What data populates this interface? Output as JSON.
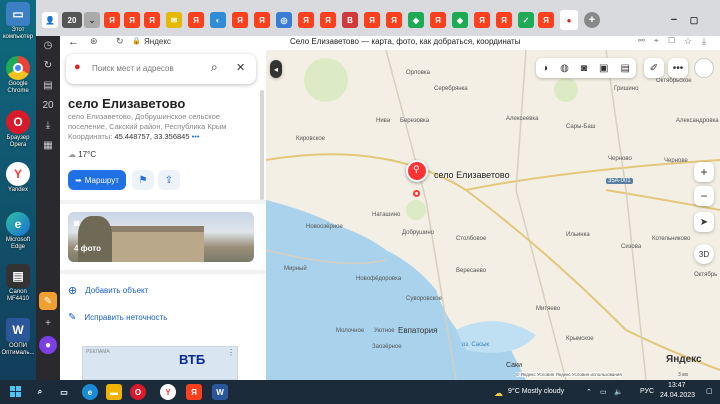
{
  "desktop": {
    "icons": [
      {
        "label": "Этот компьютер",
        "icon": "computer-icon",
        "color": "#3b7fc4"
      },
      {
        "label": "Google Chrome",
        "icon": "chrome-icon",
        "color": "#e8443a"
      },
      {
        "label": "Браузер Opera",
        "icon": "opera-icon",
        "color": "#d91a2a"
      },
      {
        "label": "Yandex",
        "icon": "yandex-icon",
        "color": "#ff3333"
      },
      {
        "label": "Microsoft Edge",
        "icon": "edge-icon",
        "color": "#1c8bd6"
      },
      {
        "label": "Canon MF4410",
        "icon": "printer-icon",
        "color": "#333333"
      },
      {
        "label": "ООПИ Оптималь...",
        "icon": "word-icon",
        "color": "#2b579a"
      }
    ]
  },
  "browser": {
    "tab_count": "20",
    "address": "Яндекс",
    "page_title": "Село Елизаветово — карта, фото, как добраться, координаты"
  },
  "panel": {
    "search_placeholder": "Поиск мест и адресов",
    "title": "село Елизаветово",
    "address": "село Елизаветово, Добрушинское сельское поселение, Сакский район, Республика Крым",
    "coords_label": "Координаты:",
    "coords_value": "45.448757, 33.356845",
    "temperature": "17°C",
    "route_label": "Маршрут",
    "photo_label": "4 фото",
    "add_object": "Добавить объект",
    "fix_error": "Исправить неточность",
    "ad_tag": "РЕКЛАМА",
    "ad_brand": "ВТБ"
  },
  "map": {
    "pin_label": "село Елизаветово",
    "zoom_in": "+",
    "zoom_out": "−",
    "three_d": "3D",
    "road": "35А-001",
    "scale": "3 км",
    "attribution": "© Яндекс  Условия  Яндекс  Условия использования",
    "brand": "Яндекс",
    "places": [
      {
        "name": "Орловка"
      },
      {
        "name": "Серебрянка"
      },
      {
        "name": "Октябрьское"
      },
      {
        "name": "Гришино"
      },
      {
        "name": "Кировское"
      },
      {
        "name": "Нива"
      },
      {
        "name": "Березовка"
      },
      {
        "name": "Алексеевка"
      },
      {
        "name": "Сары-Баш"
      },
      {
        "name": "Александровка"
      },
      {
        "name": "Черново"
      },
      {
        "name": "Чернове"
      },
      {
        "name": "Наташино"
      },
      {
        "name": "Новоозёрное"
      },
      {
        "name": "Добрушино"
      },
      {
        "name": "Столбовое"
      },
      {
        "name": "Ильинка"
      },
      {
        "name": "Сизова"
      },
      {
        "name": "Котельниково"
      },
      {
        "name": "Октябрь"
      },
      {
        "name": "Мирный"
      },
      {
        "name": "Новофёдоровка"
      },
      {
        "name": "Вересаево"
      },
      {
        "name": "Суворовское"
      },
      {
        "name": "Митяево"
      },
      {
        "name": "Молочное"
      },
      {
        "name": "Уютное"
      },
      {
        "name": "Евпатория"
      },
      {
        "name": "Крымское"
      },
      {
        "name": "Заозёрное"
      },
      {
        "name": "оз. Сасык"
      },
      {
        "name": "Саки"
      }
    ]
  },
  "taskbar": {
    "weather": "9°C  Mostly cloudy",
    "lang": "РУС",
    "time": "13:47",
    "date": "24.04.2023"
  }
}
